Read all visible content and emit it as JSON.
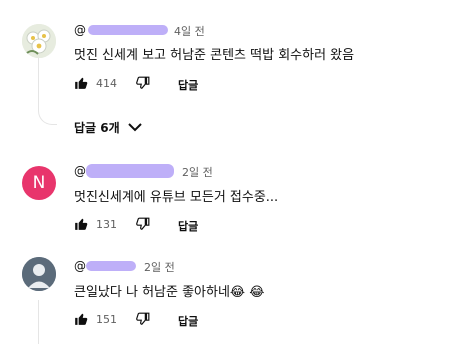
{
  "comments": [
    {
      "handle": "@",
      "time": "4일 전",
      "text": "멋진 신세계 보고 허남준 콘텐츠 떡밥 회수하러 왔음",
      "likes": "414",
      "reply_label": "답글",
      "avatar_letter": ""
    },
    {
      "handle": "@",
      "time": "2일 전",
      "text": "멋진신세계에 유튜브 모든거 접수중...",
      "likes": "131",
      "reply_label": "답글",
      "avatar_letter": "N"
    },
    {
      "handle": "@",
      "time": "2일 전",
      "text": "큰일났다 나 허남준 좋아하네😂 😂",
      "likes": "151",
      "reply_label": "답글",
      "avatar_letter": ""
    }
  ],
  "replies_toggle": "답글 6개",
  "colors": {
    "redaction": "#b7a6f7",
    "avatar_n": "#e8356c"
  },
  "icons": [
    "thumbs-up-icon",
    "thumbs-down-icon",
    "chevron-down-icon"
  ]
}
